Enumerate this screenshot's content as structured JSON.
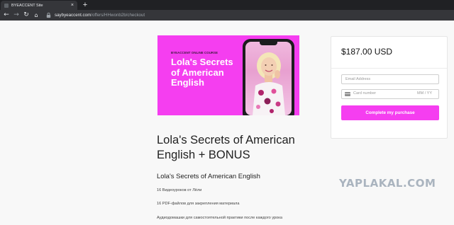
{
  "browser": {
    "tab_title": "BYEACCENT Site",
    "tab_close": "×",
    "new_tab": "+",
    "url_host": "saybyeaccent.com",
    "url_path": "/offers/HHwonb2b/checkout",
    "icons": [
      "back-arrow-icon",
      "forward-arrow-icon",
      "reload-icon",
      "home-icon",
      "lock-icon"
    ]
  },
  "course_image": {
    "kicker": "BYEACCENT ONLINE COURSE",
    "title": "Lola's Secrets of American English",
    "background_color": "#f53ef0"
  },
  "product": {
    "title": "Lola's Secrets of American English + BONUS",
    "subtitle": "Lola's Secrets of American English",
    "features": [
      "16 Видеоуроков от Лёли",
      "16 PDF-файлов для закрепления материала",
      "Аудиодомашки для самостоятельной практики после каждого урока"
    ]
  },
  "checkout": {
    "price": "$187.00 USD",
    "email_placeholder": "Email Address",
    "card_number_placeholder": "Card number",
    "expiry_placeholder": "MM / YY",
    "submit_label": "Complete my purchase",
    "accent_color": "#f53ef0"
  },
  "watermark": "YAPLAKAL.COM"
}
